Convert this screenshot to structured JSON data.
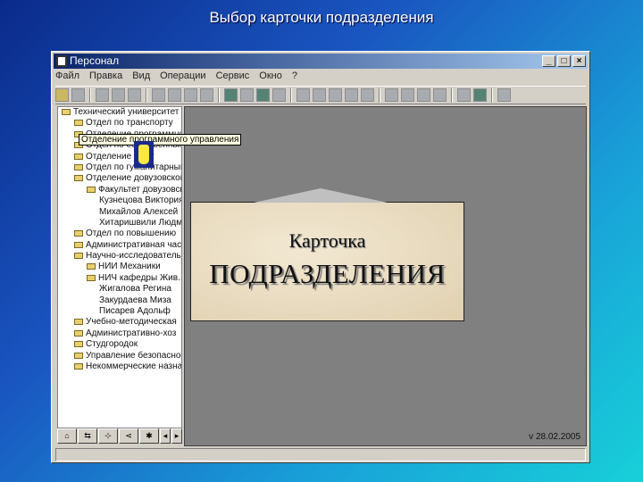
{
  "slide_title": "Выбор карточки подразделения",
  "window": {
    "title": "Персонал",
    "controls": [
      "_",
      "□",
      "×"
    ]
  },
  "menu": [
    "Файл",
    "Правка",
    "Вид",
    "Операции",
    "Сервис",
    "Окно",
    "?"
  ],
  "tree": [
    {
      "label": "Технический университет",
      "level": 0
    },
    {
      "label": "Отдел по транспорту",
      "level": 1
    },
    {
      "label": "Отделение программного управления",
      "level": 1
    },
    {
      "label": "Отдел по естественным",
      "level": 1
    },
    {
      "label": "Отделение по кт",
      "level": 1
    },
    {
      "label": "Отдел по гуманитарным",
      "level": 1
    },
    {
      "label": "Отделение довузовской",
      "level": 1
    },
    {
      "label": "Факультет довузовский",
      "level": 2
    },
    {
      "label": "Кузнецова Виктория",
      "level": 3
    },
    {
      "label": "Михайлов Алексей",
      "level": 3
    },
    {
      "label": "Хитаришвили Людмила",
      "level": 3
    },
    {
      "label": "Отдел по повышению",
      "level": 1
    },
    {
      "label": "Административная часть",
      "level": 1
    },
    {
      "label": "Научно-исследовательский",
      "level": 1
    },
    {
      "label": "НИИ Механики",
      "level": 2
    },
    {
      "label": "НИЧ кафедры Жив.",
      "level": 2
    },
    {
      "label": "Жигалова Регина",
      "level": 3
    },
    {
      "label": "Закурдаева Миза",
      "level": 3
    },
    {
      "label": "Писарев Адольф",
      "level": 3
    },
    {
      "label": "Учебно-методическая",
      "level": 1
    },
    {
      "label": "Административно-хоз",
      "level": 1
    },
    {
      "label": "Студгородок",
      "level": 1
    },
    {
      "label": "Управление безопасности",
      "level": 1
    },
    {
      "label": "Некоммерческие назначения",
      "level": 1
    }
  ],
  "tooltip": "Отделение программного управления",
  "tabs": [
    "⌂",
    "⇆",
    "⊹",
    "⋖",
    "✱",
    "◂",
    "▸"
  ],
  "card": {
    "line1": "Карточка",
    "line2": "ПОДРАЗДЕЛЕНИЯ"
  },
  "version": "v 28.02.2005"
}
